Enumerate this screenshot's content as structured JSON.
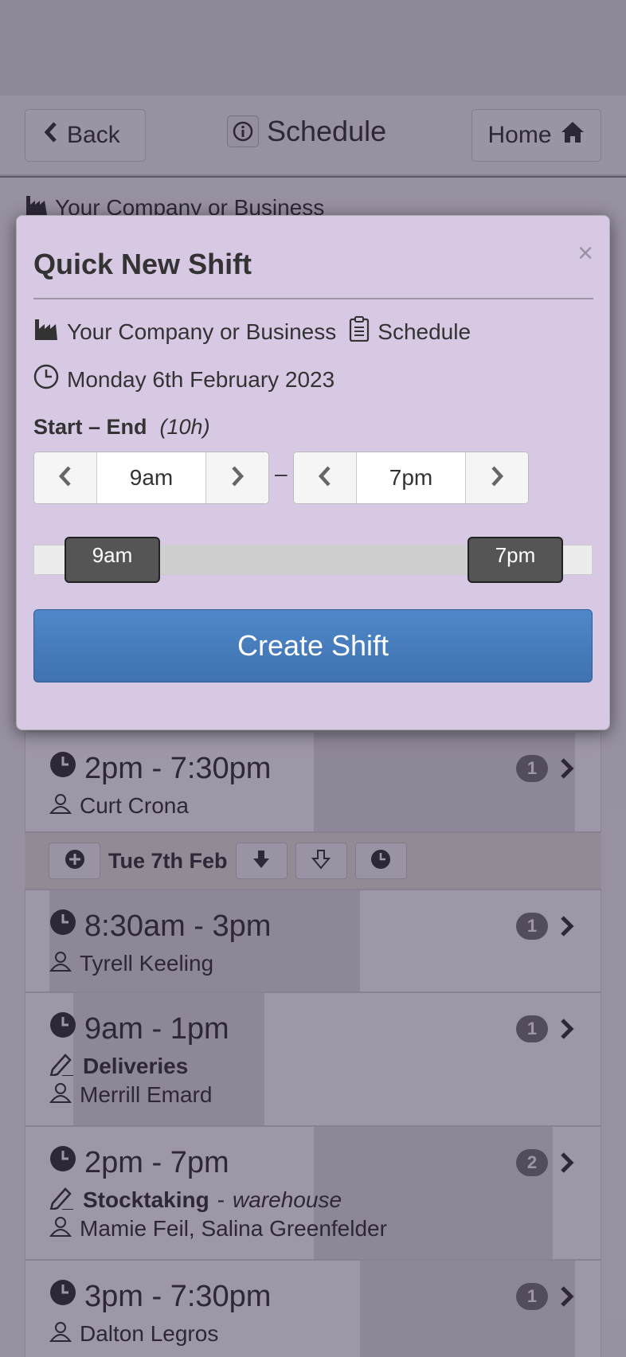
{
  "nav": {
    "back_label": "Back",
    "title": "Schedule",
    "home_label": "Home"
  },
  "page": {
    "company": "Your Company or Business"
  },
  "shifts_before": [
    {
      "time": "2pm - 7:30pm",
      "person": "Curt Crona",
      "count": "1"
    }
  ],
  "day": {
    "label": "Tue 7th Feb"
  },
  "shifts": [
    {
      "time": "8:30am - 3pm",
      "person": "Tyrell Keeling",
      "count": "1"
    },
    {
      "time": "9am - 1pm",
      "task": "Deliveries",
      "person": "Merrill Emard",
      "count": "1"
    },
    {
      "time": "2pm - 7pm",
      "task": "Stocktaking",
      "location": "warehouse",
      "person": "Mamie Feil, Salina Greenfelder",
      "count": "2"
    },
    {
      "time": "3pm - 7:30pm",
      "person": "Dalton Legros",
      "count": "1"
    }
  ],
  "modal": {
    "title": "Quick New Shift",
    "close": "×",
    "company": "Your Company or Business",
    "schedule": "Schedule",
    "date": "Monday 6th February 2023",
    "range_label": "Start – End",
    "duration": "(10h)",
    "start_value": "9am",
    "end_value": "7pm",
    "dash": "–",
    "slider_start": "9am",
    "slider_end": "7pm",
    "create_label": "Create Shift"
  }
}
